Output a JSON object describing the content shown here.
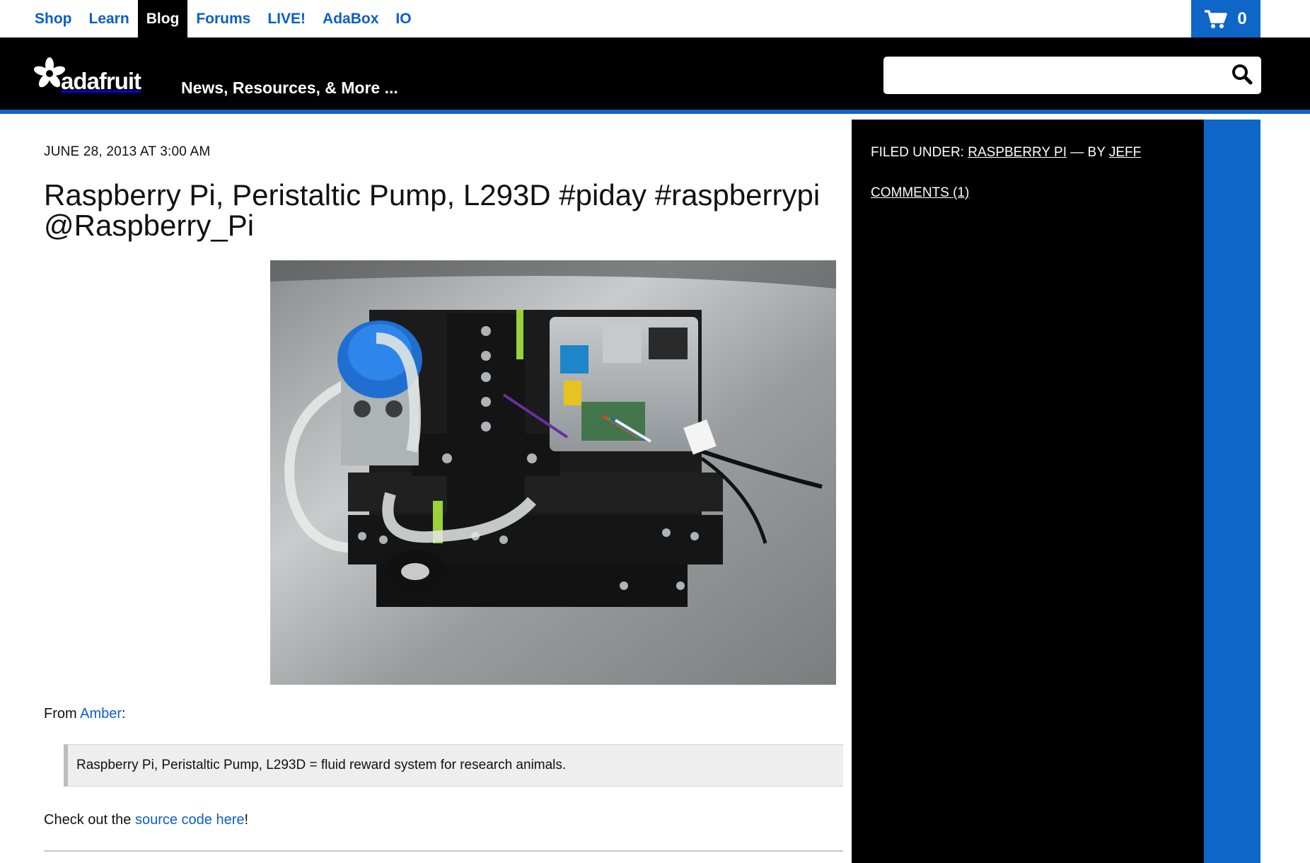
{
  "topnav": {
    "links": [
      {
        "label": "Shop"
      },
      {
        "label": "Learn"
      },
      {
        "label": "Blog",
        "active": true
      },
      {
        "label": "Forums"
      },
      {
        "label": "LIVE!"
      },
      {
        "label": "AdaBox"
      },
      {
        "label": "IO"
      }
    ],
    "cart_count": "0"
  },
  "header": {
    "logo_text": "adafruit",
    "tagline": "News, Resources, & More ...",
    "search_placeholder": ""
  },
  "article": {
    "date": "JUNE 28, 2013 AT 3:00 AM",
    "title": "Raspberry Pi, Peristaltic Pump, L293D #piday #raspberrypi @Raspberry_Pi",
    "from_prefix": "From ",
    "from_link": "Amber",
    "from_suffix": ":",
    "quote": "Raspberry Pi, Peristaltic Pump, L293D = fluid reward system for research animals.",
    "check_prefix": "Check out the ",
    "check_link": "source code here",
    "check_suffix": "!"
  },
  "sidebar": {
    "filed_under_label": "FILED UNDER: ",
    "category": "RASPBERRY PI",
    "by_label": " — BY ",
    "author": "JEFF",
    "comments": "COMMENTS (1)"
  },
  "colors": {
    "link_blue": "#0c5ec7",
    "brand_blue": "#0d66c8",
    "header_black": "#000000"
  }
}
